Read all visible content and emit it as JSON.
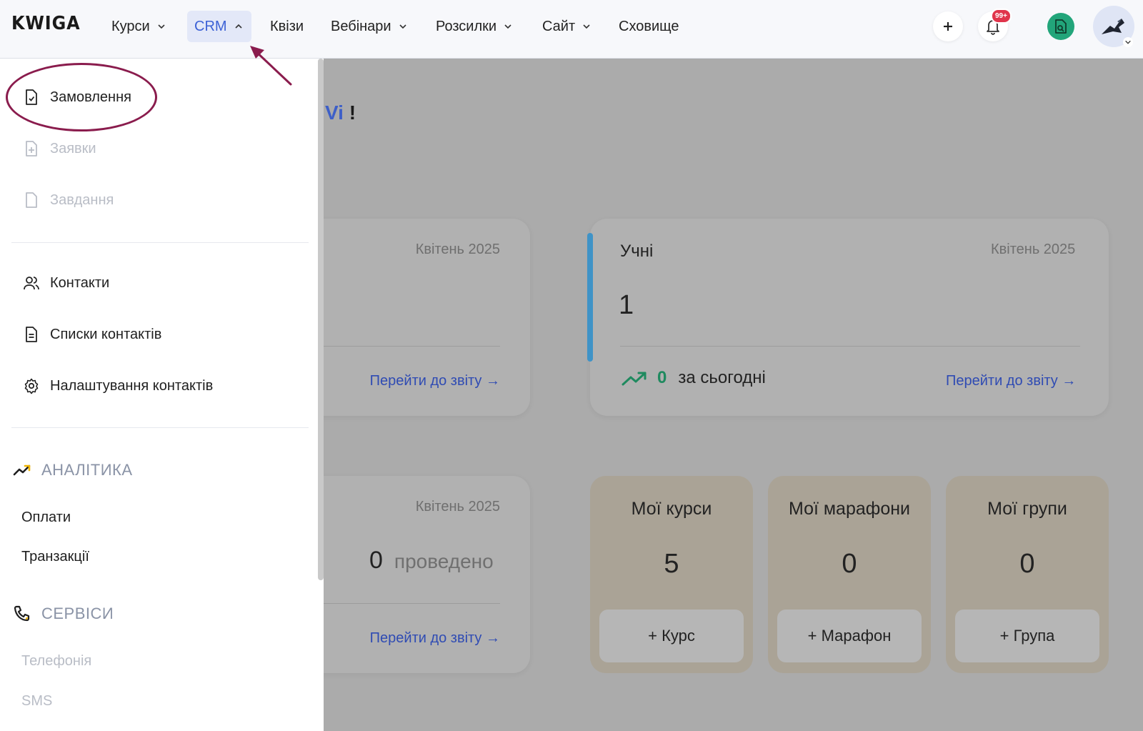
{
  "header": {
    "logo": "KWIGA",
    "nav": [
      {
        "label": "Курси",
        "has_dropdown": true,
        "active": false
      },
      {
        "label": "CRM",
        "has_dropdown": true,
        "active": true
      },
      {
        "label": "Квізи",
        "has_dropdown": false,
        "active": false
      },
      {
        "label": "Вебінари",
        "has_dropdown": true,
        "active": false
      },
      {
        "label": "Розсилки",
        "has_dropdown": true,
        "active": false
      },
      {
        "label": "Сайт",
        "has_dropdown": true,
        "active": false
      },
      {
        "label": "Сховище",
        "has_dropdown": false,
        "active": false
      }
    ],
    "notifications_badge": "99+",
    "add_icon": "plus-icon",
    "bell_icon": "bell-icon",
    "doc_icon": "document-search-icon"
  },
  "sidebar": {
    "crm_items": [
      {
        "label": "Замовлення",
        "icon": "order-document-icon",
        "disabled": false
      },
      {
        "label": "Заявки",
        "icon": "request-document-icon",
        "disabled": true
      },
      {
        "label": "Завдання",
        "icon": "task-document-icon",
        "disabled": true
      }
    ],
    "contact_items": [
      {
        "label": "Контакти",
        "icon": "users-icon"
      },
      {
        "label": "Списки контактів",
        "icon": "list-document-icon"
      },
      {
        "label": "Налаштування контактів",
        "icon": "gear-icon"
      }
    ],
    "analytics": {
      "title": "АНАЛІТИКА",
      "items": [
        {
          "label": "Оплати",
          "disabled": false
        },
        {
          "label": "Транзакції",
          "disabled": false
        }
      ]
    },
    "services": {
      "title": "СЕРВІСИ",
      "items": [
        {
          "label": "Телефонія",
          "disabled": true
        },
        {
          "label": "SMS",
          "disabled": true
        }
      ]
    }
  },
  "main": {
    "greeting_highlight": "Vi",
    "greeting_end": "!",
    "card_left_top": {
      "date": "Квітень 2025",
      "link": "Перейти до звіту →"
    },
    "card_students": {
      "title": "Учні",
      "date": "Квітень 2025",
      "value": "1",
      "today_count": "0",
      "today_label": "за сьогодні",
      "link": "Перейти до звіту →"
    },
    "card_left_bottom": {
      "date": "Квітень 2025",
      "value": "0",
      "value_label": "проведено",
      "link": "Перейти до звіту →"
    },
    "tiles": [
      {
        "title": "Мої курси",
        "value": "5",
        "button": "+ Курс"
      },
      {
        "title": "Мої марафони",
        "value": "0",
        "button": "+ Марафон"
      },
      {
        "title": "Мої групи",
        "value": "0",
        "button": "+ Група"
      }
    ]
  }
}
